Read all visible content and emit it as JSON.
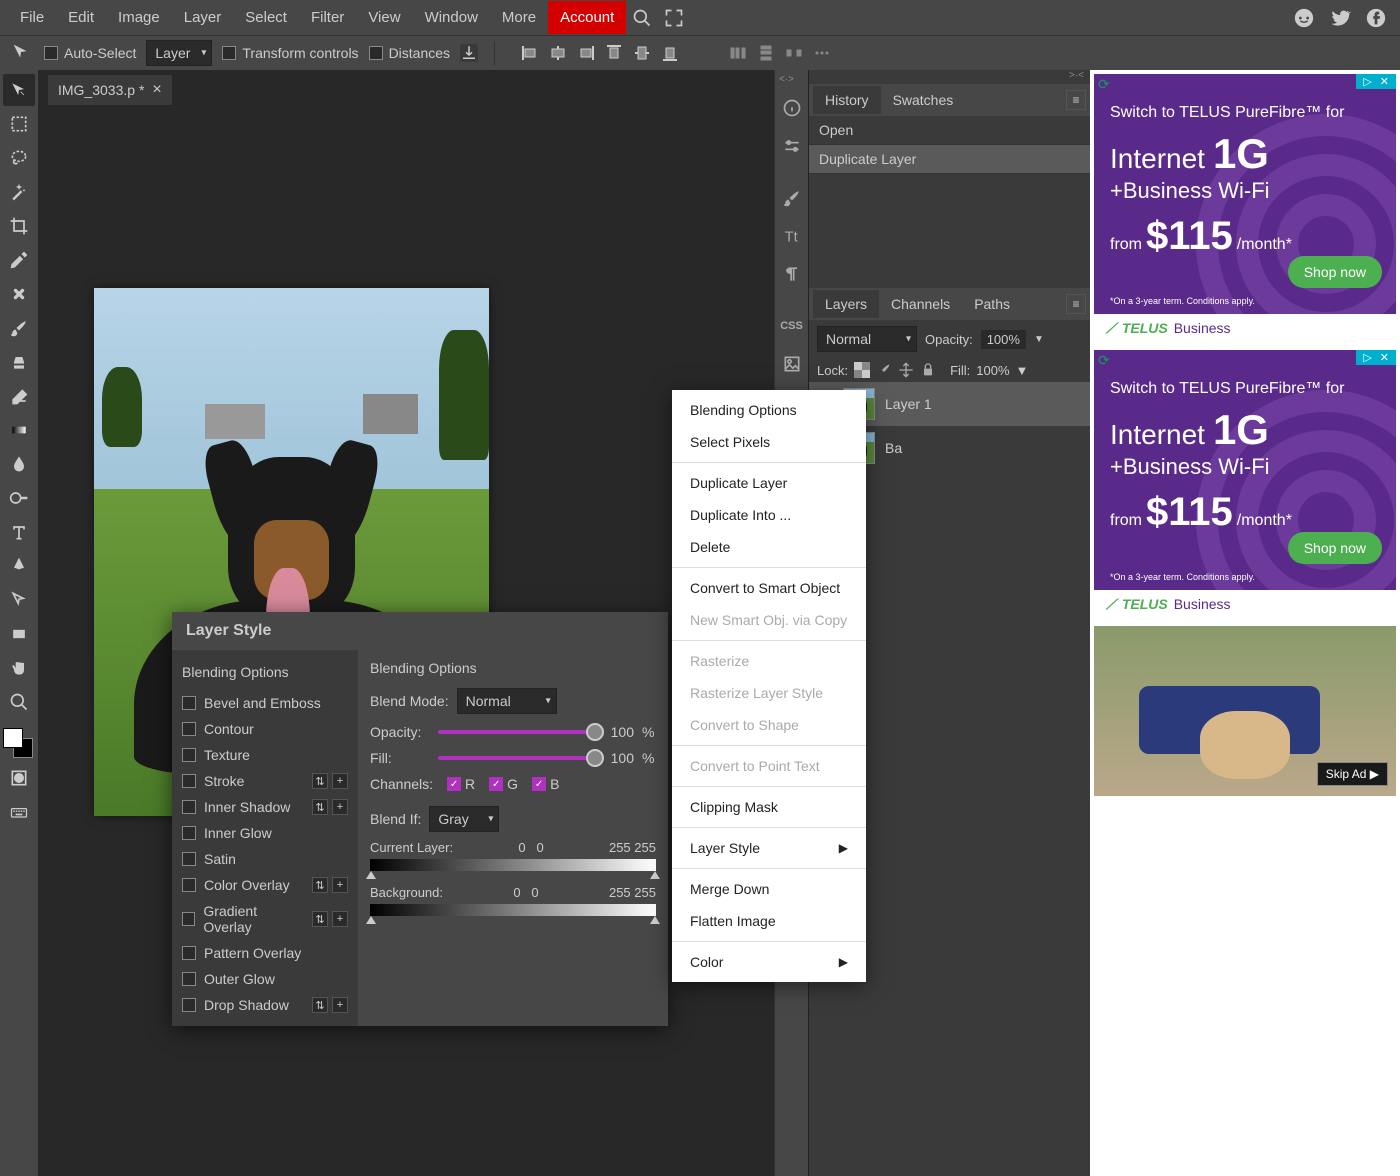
{
  "menubar": {
    "items": [
      "File",
      "Edit",
      "Image",
      "Layer",
      "Select",
      "Filter",
      "View",
      "Window",
      "More"
    ],
    "account": "Account"
  },
  "optionsbar": {
    "auto_select": "Auto-Select",
    "target": "Layer",
    "transform": "Transform controls",
    "distances": "Distances"
  },
  "document": {
    "tab_name": "IMG_3033.p *"
  },
  "history": {
    "tabs": [
      "History",
      "Swatches"
    ],
    "items": [
      "Open",
      "Duplicate Layer"
    ]
  },
  "layers": {
    "tabs": [
      "Layers",
      "Channels",
      "Paths"
    ],
    "blend_mode": "Normal",
    "opacity_label": "Opacity:",
    "opacity_value": "100%",
    "lock_label": "Lock:",
    "fill_label": "Fill:",
    "fill_value": "100%",
    "items": [
      {
        "name": "Layer 1"
      },
      {
        "name": "Ba"
      }
    ]
  },
  "layer_style": {
    "title": "Layer Style",
    "left_header": "Blending Options",
    "effects": [
      {
        "label": "Bevel and Emboss",
        "btns": false
      },
      {
        "label": "Contour",
        "btns": false
      },
      {
        "label": "Texture",
        "btns": false
      },
      {
        "label": "Stroke",
        "btns": true
      },
      {
        "label": "Inner Shadow",
        "btns": true
      },
      {
        "label": "Inner Glow",
        "btns": false
      },
      {
        "label": "Satin",
        "btns": false
      },
      {
        "label": "Color Overlay",
        "btns": true
      },
      {
        "label": "Gradient Overlay",
        "btns": true
      },
      {
        "label": "Pattern Overlay",
        "btns": false
      },
      {
        "label": "Outer Glow",
        "btns": false
      },
      {
        "label": "Drop Shadow",
        "btns": true
      }
    ],
    "right_title": "Blending Options",
    "blend_mode_label": "Blend Mode:",
    "blend_mode_value": "Normal",
    "opacity_label": "Opacity:",
    "opacity_value": "100",
    "pct": "%",
    "fill_label": "Fill:",
    "fill_value": "100",
    "channels_label": "Channels:",
    "channels": [
      "R",
      "G",
      "B"
    ],
    "blendif_label": "Blend If:",
    "blendif_value": "Gray",
    "current_layer_label": "Current Layer:",
    "current_layer_values": [
      "0",
      "0",
      "255",
      "255"
    ],
    "background_label": "Background:",
    "background_values": [
      "0",
      "0",
      "255",
      "255"
    ]
  },
  "context_menu": {
    "items": [
      {
        "label": "Blending Options",
        "enabled": true
      },
      {
        "label": "Select Pixels",
        "enabled": true
      },
      {
        "sep": true
      },
      {
        "label": "Duplicate Layer",
        "enabled": true
      },
      {
        "label": "Duplicate Into ...",
        "enabled": true
      },
      {
        "label": "Delete",
        "enabled": true
      },
      {
        "sep": true
      },
      {
        "label": "Convert to Smart Object",
        "enabled": true
      },
      {
        "label": "New Smart Obj. via Copy",
        "enabled": false
      },
      {
        "sep": true
      },
      {
        "label": "Rasterize",
        "enabled": false
      },
      {
        "label": "Rasterize Layer Style",
        "enabled": false
      },
      {
        "label": "Convert to Shape",
        "enabled": false
      },
      {
        "sep": true
      },
      {
        "label": "Convert to Point Text",
        "enabled": false
      },
      {
        "sep": true
      },
      {
        "label": "Clipping Mask",
        "enabled": true
      },
      {
        "sep": true
      },
      {
        "label": "Layer Style",
        "enabled": true,
        "submenu": true
      },
      {
        "sep": true
      },
      {
        "label": "Merge Down",
        "enabled": true
      },
      {
        "label": "Flatten Image",
        "enabled": true
      },
      {
        "sep": true
      },
      {
        "label": "Color",
        "enabled": true,
        "submenu": true
      }
    ]
  },
  "ads": {
    "telus": {
      "line1": "Switch to TELUS PureFibre™ for",
      "internet": "Internet",
      "speed": "1G",
      "wifi": "+Business Wi-Fi",
      "from": "from",
      "price": "$115",
      "per": "/month*",
      "shop": "Shop now",
      "terms": "*On a 3-year term. Conditions apply.",
      "brand": "TELUS",
      "sub": "Business"
    },
    "skip": "Skip Ad ▶"
  }
}
